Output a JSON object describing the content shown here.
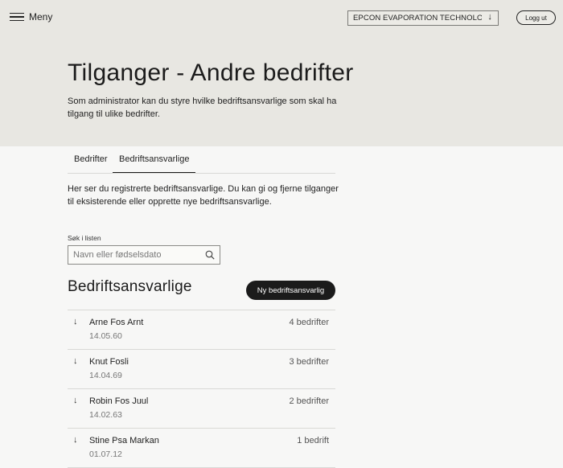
{
  "header": {
    "menu_label": "Meny",
    "company_selected": "EPCON EVAPORATION TECHNOLO...",
    "logout_label": "Logg ut"
  },
  "hero": {
    "title": "Tilganger - Andre bedrifter",
    "intro": "Som administrator kan du styre hvilke bedriftsansvarlige som skal ha tilgang til ulike bedrifter."
  },
  "tabs": [
    {
      "label": "Bedrifter",
      "active": false
    },
    {
      "label": "Bedriftsansvarlige",
      "active": true
    }
  ],
  "description": "Her ser du registrerte bedriftsansvarlige. Du kan gi og fjerne tilganger til eksisterende eller opprette nye bedriftsansvarlige.",
  "search": {
    "label": "Søk i listen",
    "placeholder": "Navn eller fødselsdato",
    "value": ""
  },
  "list": {
    "title": "Bedriftsansvarlige",
    "new_button": "Ny bedriftsansvarlig",
    "rows": [
      {
        "name": "Arne Fos Arnt",
        "dob": "14.05.60",
        "count": "4 bedrifter"
      },
      {
        "name": "Knut Fosli",
        "dob": "14.04.69",
        "count": "3 bedrifter"
      },
      {
        "name": "Robin Fos Juul",
        "dob": "14.02.63",
        "count": "2 bedrifter"
      },
      {
        "name": "Stine Psa Markan",
        "dob": "01.07.12",
        "count": "1 bedrift"
      }
    ]
  },
  "icons": {
    "menu": "hamburger-icon",
    "select_arrow": "arrow-down-icon",
    "search": "search-icon",
    "row_expand": "arrow-down-icon"
  },
  "colors": {
    "hero_bg": "#e8e7e2",
    "page_bg": "#f7f7f6",
    "primary_button": "#1b1b1b"
  }
}
